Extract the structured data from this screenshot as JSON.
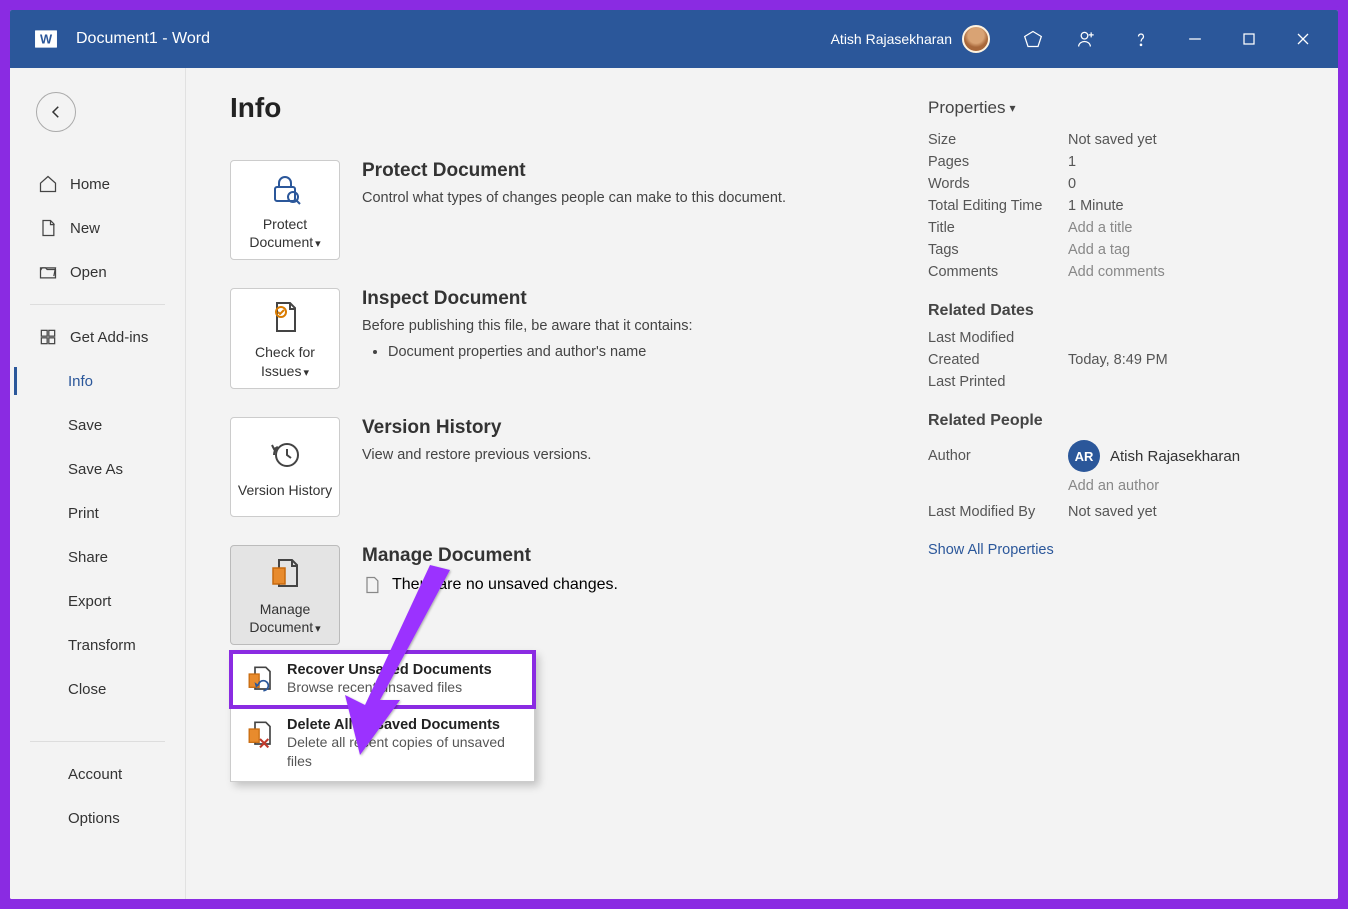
{
  "titlebar": {
    "document_title": "Document1  -  Word",
    "username": "Atish Rajasekharan"
  },
  "sidebar": {
    "items": [
      {
        "label": "Home"
      },
      {
        "label": "New"
      },
      {
        "label": "Open"
      },
      {
        "label": "Get Add-ins"
      },
      {
        "label": "Info"
      },
      {
        "label": "Save"
      },
      {
        "label": "Save As"
      },
      {
        "label": "Print"
      },
      {
        "label": "Share"
      },
      {
        "label": "Export"
      },
      {
        "label": "Transform"
      },
      {
        "label": "Close"
      },
      {
        "label": "Account"
      },
      {
        "label": "Options"
      }
    ]
  },
  "page": {
    "title": "Info"
  },
  "sections": {
    "protect": {
      "btn_label": "Protect Document",
      "title": "Protect Document",
      "desc": "Control what types of changes people can make to this document."
    },
    "inspect": {
      "btn_label": "Check for Issues",
      "title": "Inspect Document",
      "desc": "Before publishing this file, be aware that it contains:",
      "bullet1": "Document properties and author's name"
    },
    "versions": {
      "btn_label": "Version History",
      "title": "Version History",
      "desc": "View and restore previous versions."
    },
    "manage": {
      "btn_label": "Manage Document",
      "title": "Manage Document",
      "desc": "There are no unsaved changes."
    }
  },
  "dropdown": {
    "recover": {
      "title": "Recover Unsaved Documents",
      "sub": "Browse recent unsaved files"
    },
    "delete": {
      "title": "Delete All Unsaved Documents",
      "sub": "Delete all recent copies of unsaved files"
    }
  },
  "properties": {
    "header": "Properties",
    "size_label": "Size",
    "size_val": "Not saved yet",
    "pages_label": "Pages",
    "pages_val": "1",
    "words_label": "Words",
    "words_val": "0",
    "edit_time_label": "Total Editing Time",
    "edit_time_val": "1 Minute",
    "title_label": "Title",
    "title_val": "Add a title",
    "tags_label": "Tags",
    "tags_val": "Add a tag",
    "comments_label": "Comments",
    "comments_val": "Add comments",
    "dates_header": "Related Dates",
    "modified_label": "Last Modified",
    "created_label": "Created",
    "created_val": "Today, 8:49 PM",
    "printed_label": "Last Printed",
    "people_header": "Related People",
    "author_label": "Author",
    "author_name": "Atish Rajasekharan",
    "author_initials": "AR",
    "add_author": "Add an author",
    "lastmod_label": "Last Modified By",
    "lastmod_val": "Not saved yet",
    "show_all": "Show All Properties"
  }
}
